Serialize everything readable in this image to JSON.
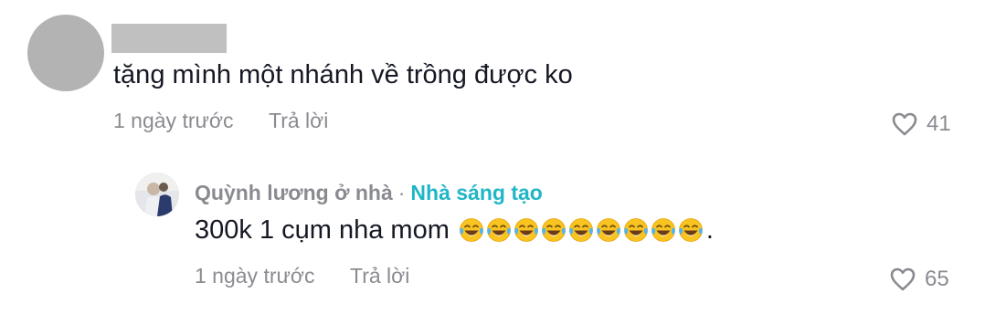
{
  "comment": {
    "text": "tặng mình một nhánh về trồng được ko",
    "time": "1 ngày trước",
    "reply_label": "Trả lời",
    "like_count": "41"
  },
  "reply": {
    "username": "Quỳnh lương ở nhà",
    "separator": "·",
    "creator_badge": "Nhà sáng tạo",
    "text": "300k 1 cụm nha mom",
    "emoji_icon": "face-with-tears-of-joy-icon",
    "emoji_count": 9,
    "text_tail": ".",
    "time": "1 ngày trước",
    "reply_label": "Trả lời",
    "like_count": "65"
  },
  "colors": {
    "primary_text": "#161823",
    "secondary_text": "#8a8b91",
    "creator_badge": "#20b6c7",
    "avatar_placeholder": "#b3b3b3"
  }
}
